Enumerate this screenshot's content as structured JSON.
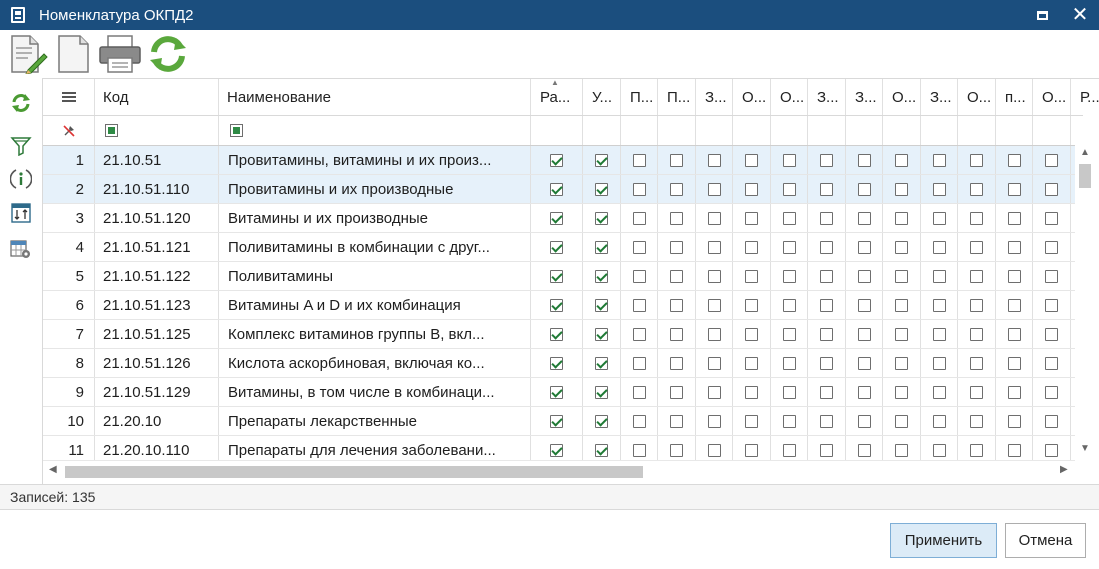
{
  "window": {
    "title": "Номенклатура ОКПД2"
  },
  "toolbar": {
    "buttons": [
      "edit-document-icon",
      "new-document-icon",
      "print-icon",
      "refresh-icon"
    ]
  },
  "rail": {
    "buttons": [
      "refresh-icon",
      "filter-icon",
      "info-icon",
      "sort-icon",
      "table-settings-icon"
    ]
  },
  "grid": {
    "columns": {
      "menu": "≡",
      "code": "Код",
      "name": "Наименование",
      "flags": [
        "Ра...",
        "У...",
        "П...",
        "П...",
        "З...",
        "О...",
        "О...",
        "З...",
        "З...",
        "О...",
        "З...",
        "О...",
        "п...",
        "О...",
        "Р..."
      ]
    },
    "rows": [
      {
        "num": "1",
        "code": "21.10.51",
        "name": "Провитамины, витамины и их произ...",
        "c1": true,
        "c2": true,
        "selected": true
      },
      {
        "num": "2",
        "code": "21.10.51.110",
        "name": "Провитамины и их производные",
        "c1": true,
        "c2": true,
        "selected": true
      },
      {
        "num": "3",
        "code": "21.10.51.120",
        "name": "Витамины и их производные",
        "c1": true,
        "c2": true,
        "selected": false
      },
      {
        "num": "4",
        "code": "21.10.51.121",
        "name": "Поливитамины в комбинации с друг...",
        "c1": true,
        "c2": true,
        "selected": false
      },
      {
        "num": "5",
        "code": "21.10.51.122",
        "name": "Поливитамины",
        "c1": true,
        "c2": true,
        "selected": false
      },
      {
        "num": "6",
        "code": "21.10.51.123",
        "name": "Витамины A и D и их комбинация",
        "c1": true,
        "c2": true,
        "selected": false
      },
      {
        "num": "7",
        "code": "21.10.51.125",
        "name": "Комплекс витаминов группы B, вкл...",
        "c1": true,
        "c2": true,
        "selected": false
      },
      {
        "num": "8",
        "code": "21.10.51.126",
        "name": "Кислота аскорбиновая, включая ко...",
        "c1": true,
        "c2": true,
        "selected": false
      },
      {
        "num": "9",
        "code": "21.10.51.129",
        "name": "Витамины, в том числе в комбинаци...",
        "c1": true,
        "c2": true,
        "selected": false
      },
      {
        "num": "10",
        "code": "21.20.10",
        "name": "Препараты лекарственные",
        "c1": true,
        "c2": true,
        "selected": false
      },
      {
        "num": "11",
        "code": "21.20.10.110",
        "name": "Препараты для лечения заболевани...",
        "c1": true,
        "c2": true,
        "selected": false
      }
    ]
  },
  "status": {
    "records": "Записей: 135"
  },
  "footer": {
    "apply_label": "Применить",
    "cancel_label": "Отмена"
  },
  "colors": {
    "titlebar": "#1b4e7e",
    "selected_row": "#e6f1fa",
    "check": "#1f7a35"
  }
}
